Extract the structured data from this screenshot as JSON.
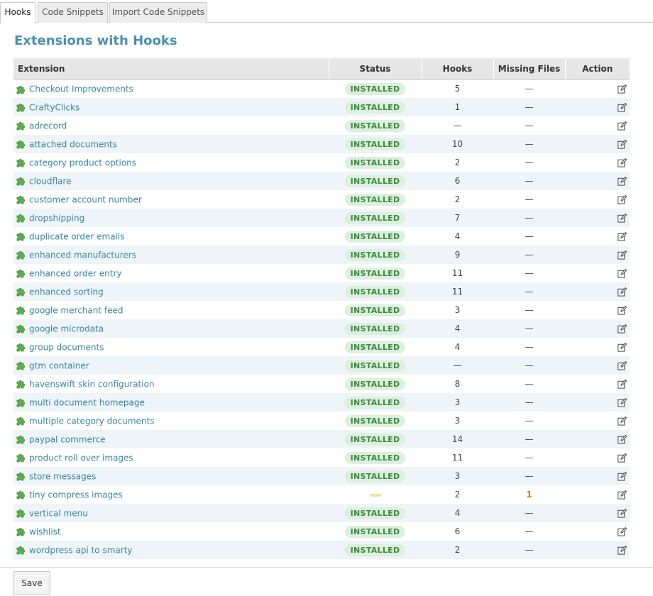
{
  "tabs": [
    {
      "label": "Hooks",
      "active": true
    },
    {
      "label": "Code Snippets",
      "active": false
    },
    {
      "label": "Import Code Snippets",
      "active": false
    }
  ],
  "title": "Extensions with Hooks",
  "table": {
    "columns": [
      "Extension",
      "Status",
      "Hooks",
      "Missing Files",
      "Action"
    ],
    "rows": [
      {
        "name": "Checkout Improvements",
        "status": "INSTALLED",
        "hooks": "5",
        "missing": "—"
      },
      {
        "name": "CraftyClicks",
        "status": "INSTALLED",
        "hooks": "1",
        "missing": "—"
      },
      {
        "name": "adrecord",
        "status": "INSTALLED",
        "hooks": "—",
        "missing": "—"
      },
      {
        "name": "attached documents",
        "status": "INSTALLED",
        "hooks": "10",
        "missing": "—"
      },
      {
        "name": "category product options",
        "status": "INSTALLED",
        "hooks": "2",
        "missing": "—"
      },
      {
        "name": "cloudflare",
        "status": "INSTALLED",
        "hooks": "6",
        "missing": "—"
      },
      {
        "name": "customer account number",
        "status": "INSTALLED",
        "hooks": "2",
        "missing": "—"
      },
      {
        "name": "dropshipping",
        "status": "INSTALLED",
        "hooks": "7",
        "missing": "—"
      },
      {
        "name": "duplicate order emails",
        "status": "INSTALLED",
        "hooks": "4",
        "missing": "—"
      },
      {
        "name": "enhanced manufacturers",
        "status": "INSTALLED",
        "hooks": "9",
        "missing": "—"
      },
      {
        "name": "enhanced order entry",
        "status": "INSTALLED",
        "hooks": "11",
        "missing": "—"
      },
      {
        "name": "enhanced sorting",
        "status": "INSTALLED",
        "hooks": "11",
        "missing": "—"
      },
      {
        "name": "google merchant feed",
        "status": "INSTALLED",
        "hooks": "3",
        "missing": "—"
      },
      {
        "name": "google microdata",
        "status": "INSTALLED",
        "hooks": "4",
        "missing": "—"
      },
      {
        "name": "group documents",
        "status": "INSTALLED",
        "hooks": "4",
        "missing": "—"
      },
      {
        "name": "gtm container",
        "status": "INSTALLED",
        "hooks": "—",
        "missing": "—"
      },
      {
        "name": "havenswift skin configuration",
        "status": "INSTALLED",
        "hooks": "8",
        "missing": "—"
      },
      {
        "name": "multi document homepage",
        "status": "INSTALLED",
        "hooks": "3",
        "missing": "—"
      },
      {
        "name": "multiple category documents",
        "status": "INSTALLED",
        "hooks": "3",
        "missing": "—"
      },
      {
        "name": "paypal commerce",
        "status": "INSTALLED",
        "hooks": "14",
        "missing": "—"
      },
      {
        "name": "product roll over images",
        "status": "INSTALLED",
        "hooks": "11",
        "missing": "—"
      },
      {
        "name": "store messages",
        "status": "INSTALLED",
        "hooks": "3",
        "missing": "—"
      },
      {
        "name": "tiny compress images",
        "status": "",
        "hooks": "2",
        "missing": "1"
      },
      {
        "name": "vertical menu",
        "status": "INSTALLED",
        "hooks": "4",
        "missing": "—"
      },
      {
        "name": "wishlist",
        "status": "INSTALLED",
        "hooks": "6",
        "missing": "—"
      },
      {
        "name": "wordpress api to smarty",
        "status": "INSTALLED",
        "hooks": "2",
        "missing": "—"
      }
    ]
  },
  "save_label": "Save",
  "colors": {
    "title": "#4a8fb0",
    "link": "#3a84a8",
    "installed_bg": "#ddefdf",
    "installed_text": "#3c8b3f",
    "missing_text": "#c47f00",
    "row_alt": "#eef4f8"
  },
  "icons": {
    "extension": "puzzle-piece-icon",
    "action": "edit-icon"
  }
}
